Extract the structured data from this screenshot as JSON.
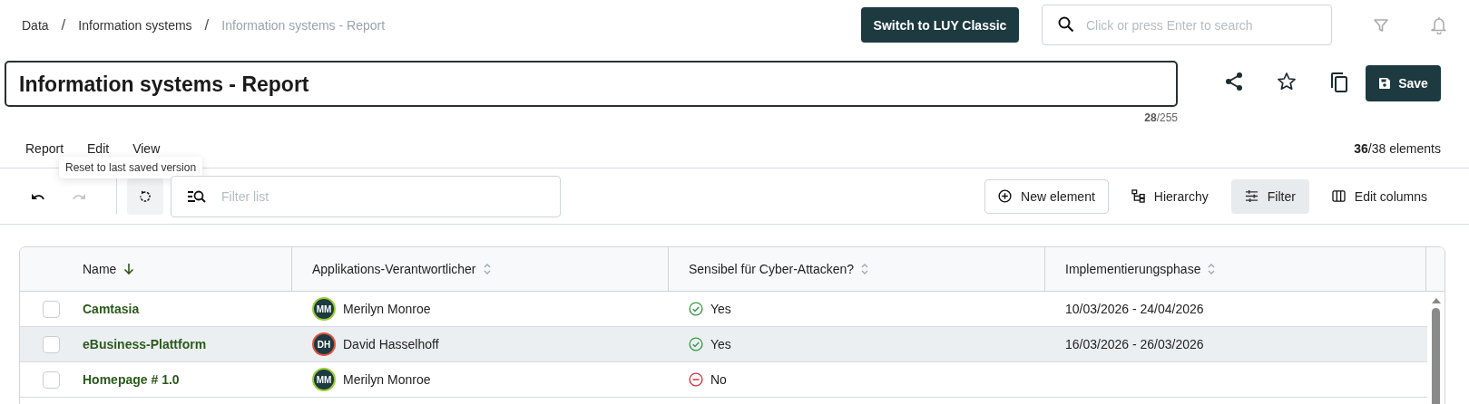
{
  "breadcrumb": [
    {
      "label": "Data",
      "current": false
    },
    {
      "label": "Information systems",
      "current": false
    },
    {
      "label": "Information systems - Report",
      "current": true
    }
  ],
  "breadcrumb_separator": "/",
  "switch_button": "Switch to LUY Classic",
  "search": {
    "placeholder": "Click or press Enter to search"
  },
  "title_field": {
    "value": "Information systems - Report",
    "count": "28",
    "max": "/255"
  },
  "save_button": "Save",
  "menu": [
    "Report",
    "Edit",
    "View"
  ],
  "element_count": {
    "shown": "36",
    "total": "/38 elements"
  },
  "tooltip": "Reset to last saved version",
  "toolbar": {
    "redo_disabled": true,
    "filter_placeholder": "Filter list"
  },
  "actions": [
    {
      "kind": "new",
      "label": "New element",
      "selected": false
    },
    {
      "kind": "hierarchy",
      "label": "Hierarchy",
      "selected": false
    },
    {
      "kind": "filter",
      "label": "Filter",
      "selected": true
    },
    {
      "kind": "columns",
      "label": "Edit columns",
      "selected": false
    }
  ],
  "table": {
    "columns": [
      {
        "label": "Name",
        "sorted": true
      },
      {
        "label": "Applikations-Verantwortlicher",
        "sorted": false
      },
      {
        "label": "Sensibel für Cyber-Attacken?",
        "sorted": false
      },
      {
        "label": "Implementierungsphase",
        "sorted": false
      }
    ],
    "rows": [
      {
        "checked": false,
        "highlighted": false,
        "name": "Camtasia",
        "owner": {
          "initials": "MM",
          "name": "Merilyn Monroe",
          "color": "#9acd32"
        },
        "sensitive": {
          "kind": "yes",
          "label": "Yes"
        },
        "phase": "10/03/2026 - 24/04/2026"
      },
      {
        "checked": false,
        "highlighted": true,
        "name": "eBusiness-Plattform",
        "owner": {
          "initials": "DH",
          "name": "David Hasselhoff",
          "color": "#e0523e"
        },
        "sensitive": {
          "kind": "yes",
          "label": "Yes"
        },
        "phase": "16/03/2026 - 26/03/2026"
      },
      {
        "checked": false,
        "highlighted": false,
        "name": "Homepage # 1.0",
        "owner": {
          "initials": "MM",
          "name": "Merilyn Monroe",
          "color": "#9acd32"
        },
        "sensitive": {
          "kind": "no",
          "label": "No"
        }
      }
    ]
  }
}
